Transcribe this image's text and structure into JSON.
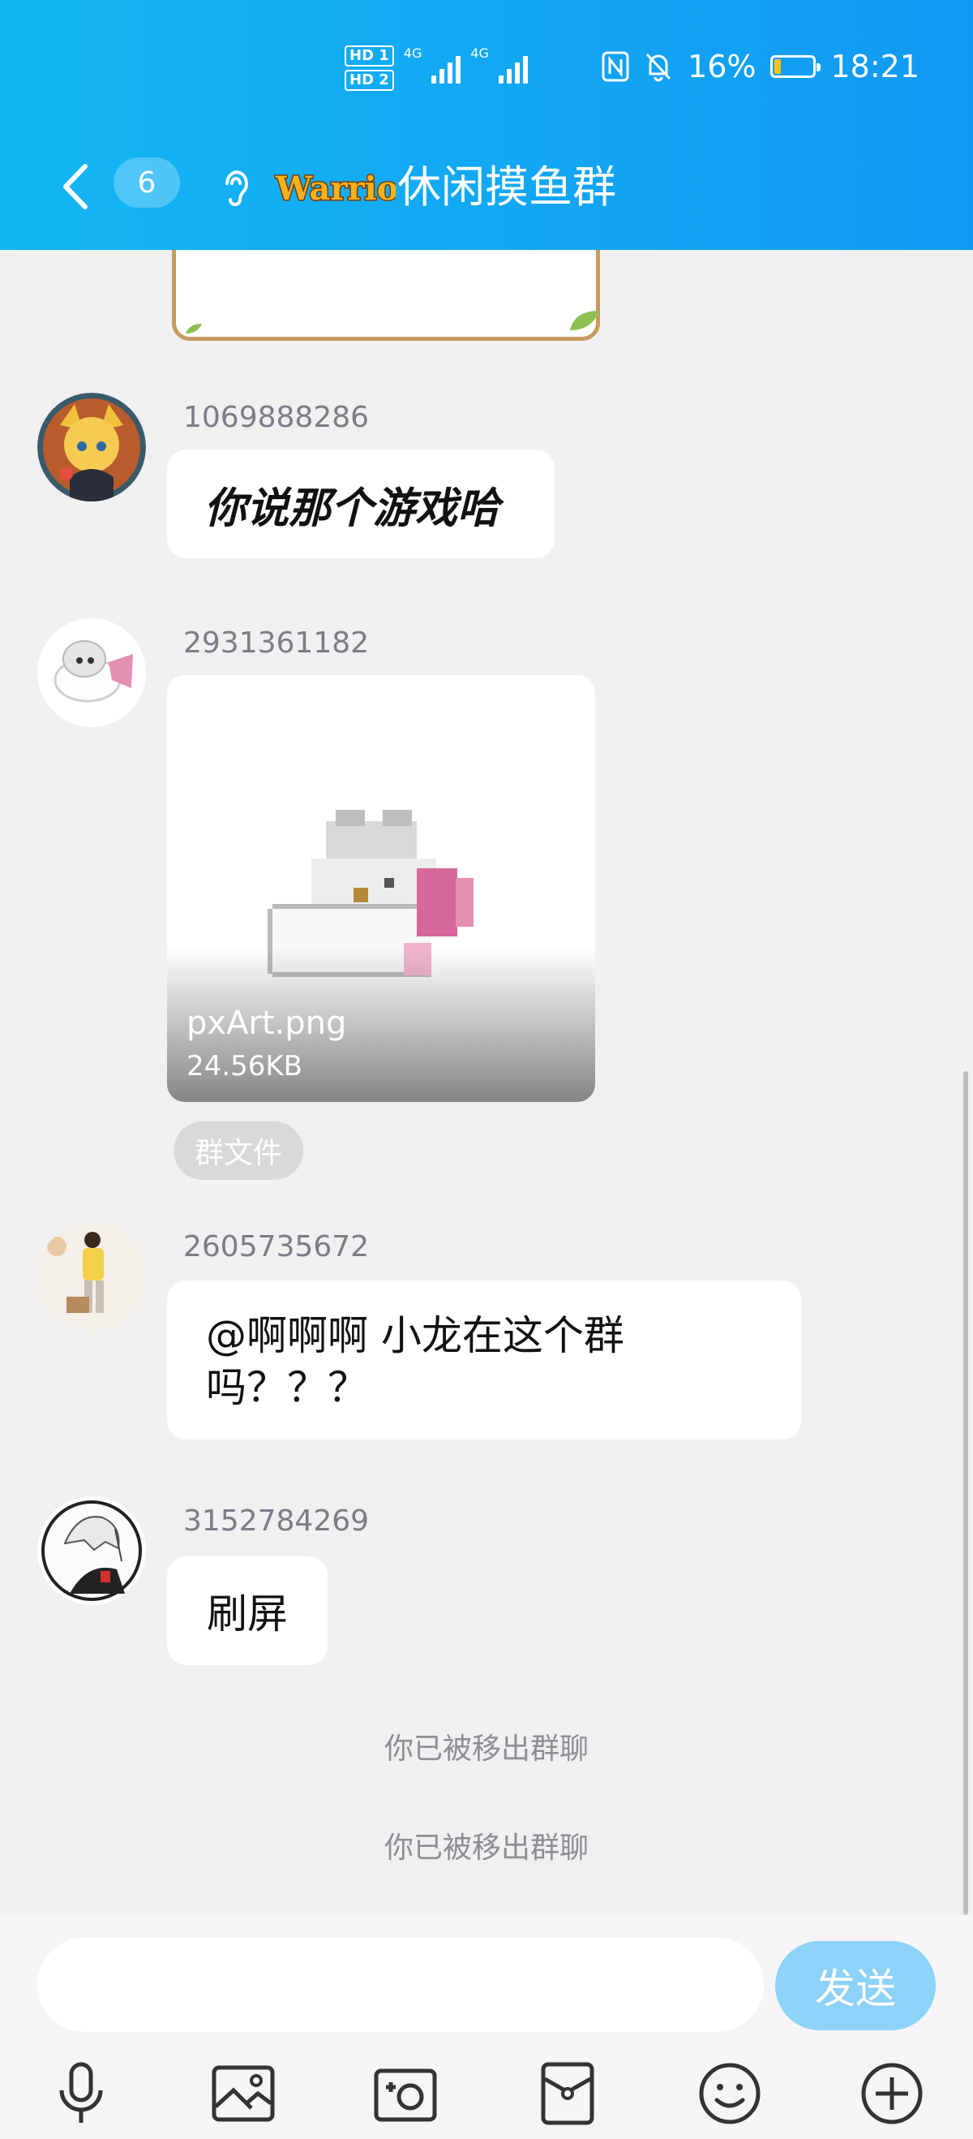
{
  "status_bar": {
    "hd1": "HD 1",
    "hd2": "HD 2",
    "net1": "4G",
    "net2": "4G",
    "battery": "16%",
    "time": "18:21"
  },
  "header": {
    "unread_count": "6",
    "logo_text": "Warrior",
    "title": "休闲摸鱼群"
  },
  "messages": [
    {
      "sender": "1069888286",
      "text": "你说那个游戏哈"
    },
    {
      "sender": "2931361182",
      "file_name": "pxArt.png",
      "file_size": "24.56KB",
      "tag": "群文件"
    },
    {
      "sender": "2605735672",
      "text_line1": "@啊啊啊 小龙在这个群",
      "text_line2": "吗？？？"
    },
    {
      "sender": "3152784269",
      "text": "刷屏"
    }
  ],
  "system_notes": [
    "你已被移出群聊",
    "你已被移出群聊"
  ],
  "composer": {
    "placeholder": "",
    "send_label": "发送"
  },
  "icons": [
    "back-icon",
    "ear-icon",
    "mic-icon",
    "image-icon",
    "camera-icon",
    "red-packet-icon",
    "emoji-icon",
    "plus-icon"
  ],
  "colors": {
    "header_start": "#14b7f4",
    "header_end": "#1199f2",
    "send_button": "#8dd2f8",
    "background": "#f0f0f0"
  }
}
